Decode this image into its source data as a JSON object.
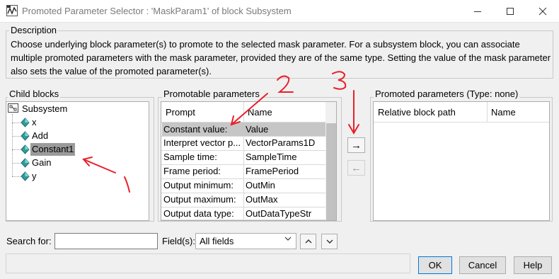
{
  "window": {
    "title": "Promoted Parameter Selector : 'MaskParam1' of block Subsystem",
    "icon": "simulink-icon"
  },
  "description": {
    "title": "Description",
    "text": "Choose underlying block parameter(s) to promote to the selected mask parameter. For a subsystem block, you can associate multiple promoted parameters with the mask parameter, provided they are of the same type. Setting the value of the mask parameter also sets the value of the promoted parameter(s)."
  },
  "child_blocks": {
    "title": "Child blocks",
    "root": "Subsystem",
    "items": [
      "x",
      "Add",
      "Constant1",
      "Gain",
      "y"
    ],
    "selected": "Constant1"
  },
  "promotable": {
    "title": "Promotable parameters",
    "columns": [
      "Prompt",
      "Name"
    ],
    "rows": [
      [
        "Constant value:",
        "Value"
      ],
      [
        "Interpret vector p...",
        "VectorParams1D"
      ],
      [
        "Sample time:",
        "SampleTime"
      ],
      [
        "Frame period:",
        "FramePeriod"
      ],
      [
        "Output minimum:",
        "OutMin"
      ],
      [
        "Output maximum:",
        "OutMax"
      ],
      [
        "Output data type:",
        "OutDataTypeStr"
      ]
    ],
    "selected_row": 0
  },
  "promoted": {
    "title": "Promoted parameters (Type: none)",
    "columns": [
      "Relative block path",
      "Name"
    ]
  },
  "search": {
    "label": "Search for:",
    "value": "",
    "fields_label": "Field(s):",
    "fields_value": "All fields"
  },
  "buttons": {
    "ok": "OK",
    "cancel": "Cancel",
    "help": "Help",
    "add": "→",
    "remove": "←"
  },
  "annotations": {
    "labels": [
      "1",
      "2",
      "3"
    ],
    "color": "#e8202a"
  }
}
